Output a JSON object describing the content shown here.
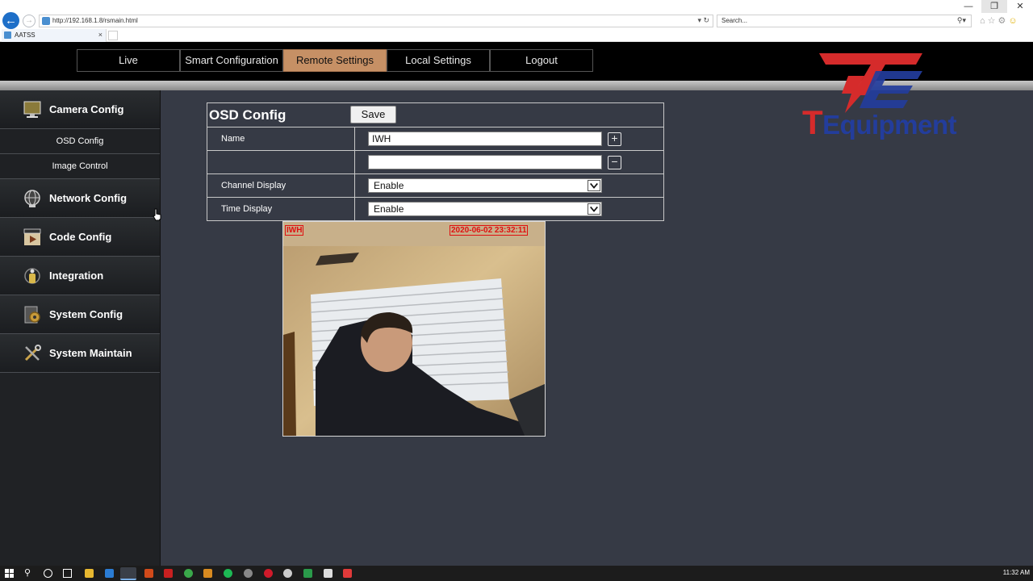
{
  "browser": {
    "url": "http://192.168.1.8/rsmain.html",
    "search_placeholder": "Search...",
    "tab_title": "AATSS"
  },
  "nav": {
    "items": [
      {
        "label": "Live"
      },
      {
        "label": "Smart Configuration"
      },
      {
        "label": "Remote Settings",
        "active": true
      },
      {
        "label": "Local Settings"
      },
      {
        "label": "Logout"
      }
    ]
  },
  "sidebar": {
    "camera_config": "Camera Config",
    "osd_config": "OSD Config",
    "image_control": "Image Control",
    "network_config": "Network Config",
    "code_config": "Code Config",
    "integration": "Integration",
    "system_config": "System Config",
    "system_maintain": "System Maintain"
  },
  "osd": {
    "title": "OSD Config",
    "save_label": "Save",
    "name_label": "Name",
    "name_value": "IWH",
    "extra_value": "",
    "channel_display_label": "Channel Display",
    "channel_display_value": "Enable",
    "time_display_label": "Time Display",
    "time_display_value": "Enable"
  },
  "preview": {
    "overlay_name": "IWH",
    "overlay_time": "2020-06-02 23:32:11"
  },
  "logo": {
    "word_t": "T",
    "word_rest": "Equipment"
  },
  "taskbar": {
    "clock": "11:32 AM"
  },
  "colors": {
    "accent_tab": "#c69065",
    "background": "#363a45",
    "overlay_red": "#e01010",
    "logo_red": "#d52b2b",
    "logo_blue": "#233d9c"
  }
}
